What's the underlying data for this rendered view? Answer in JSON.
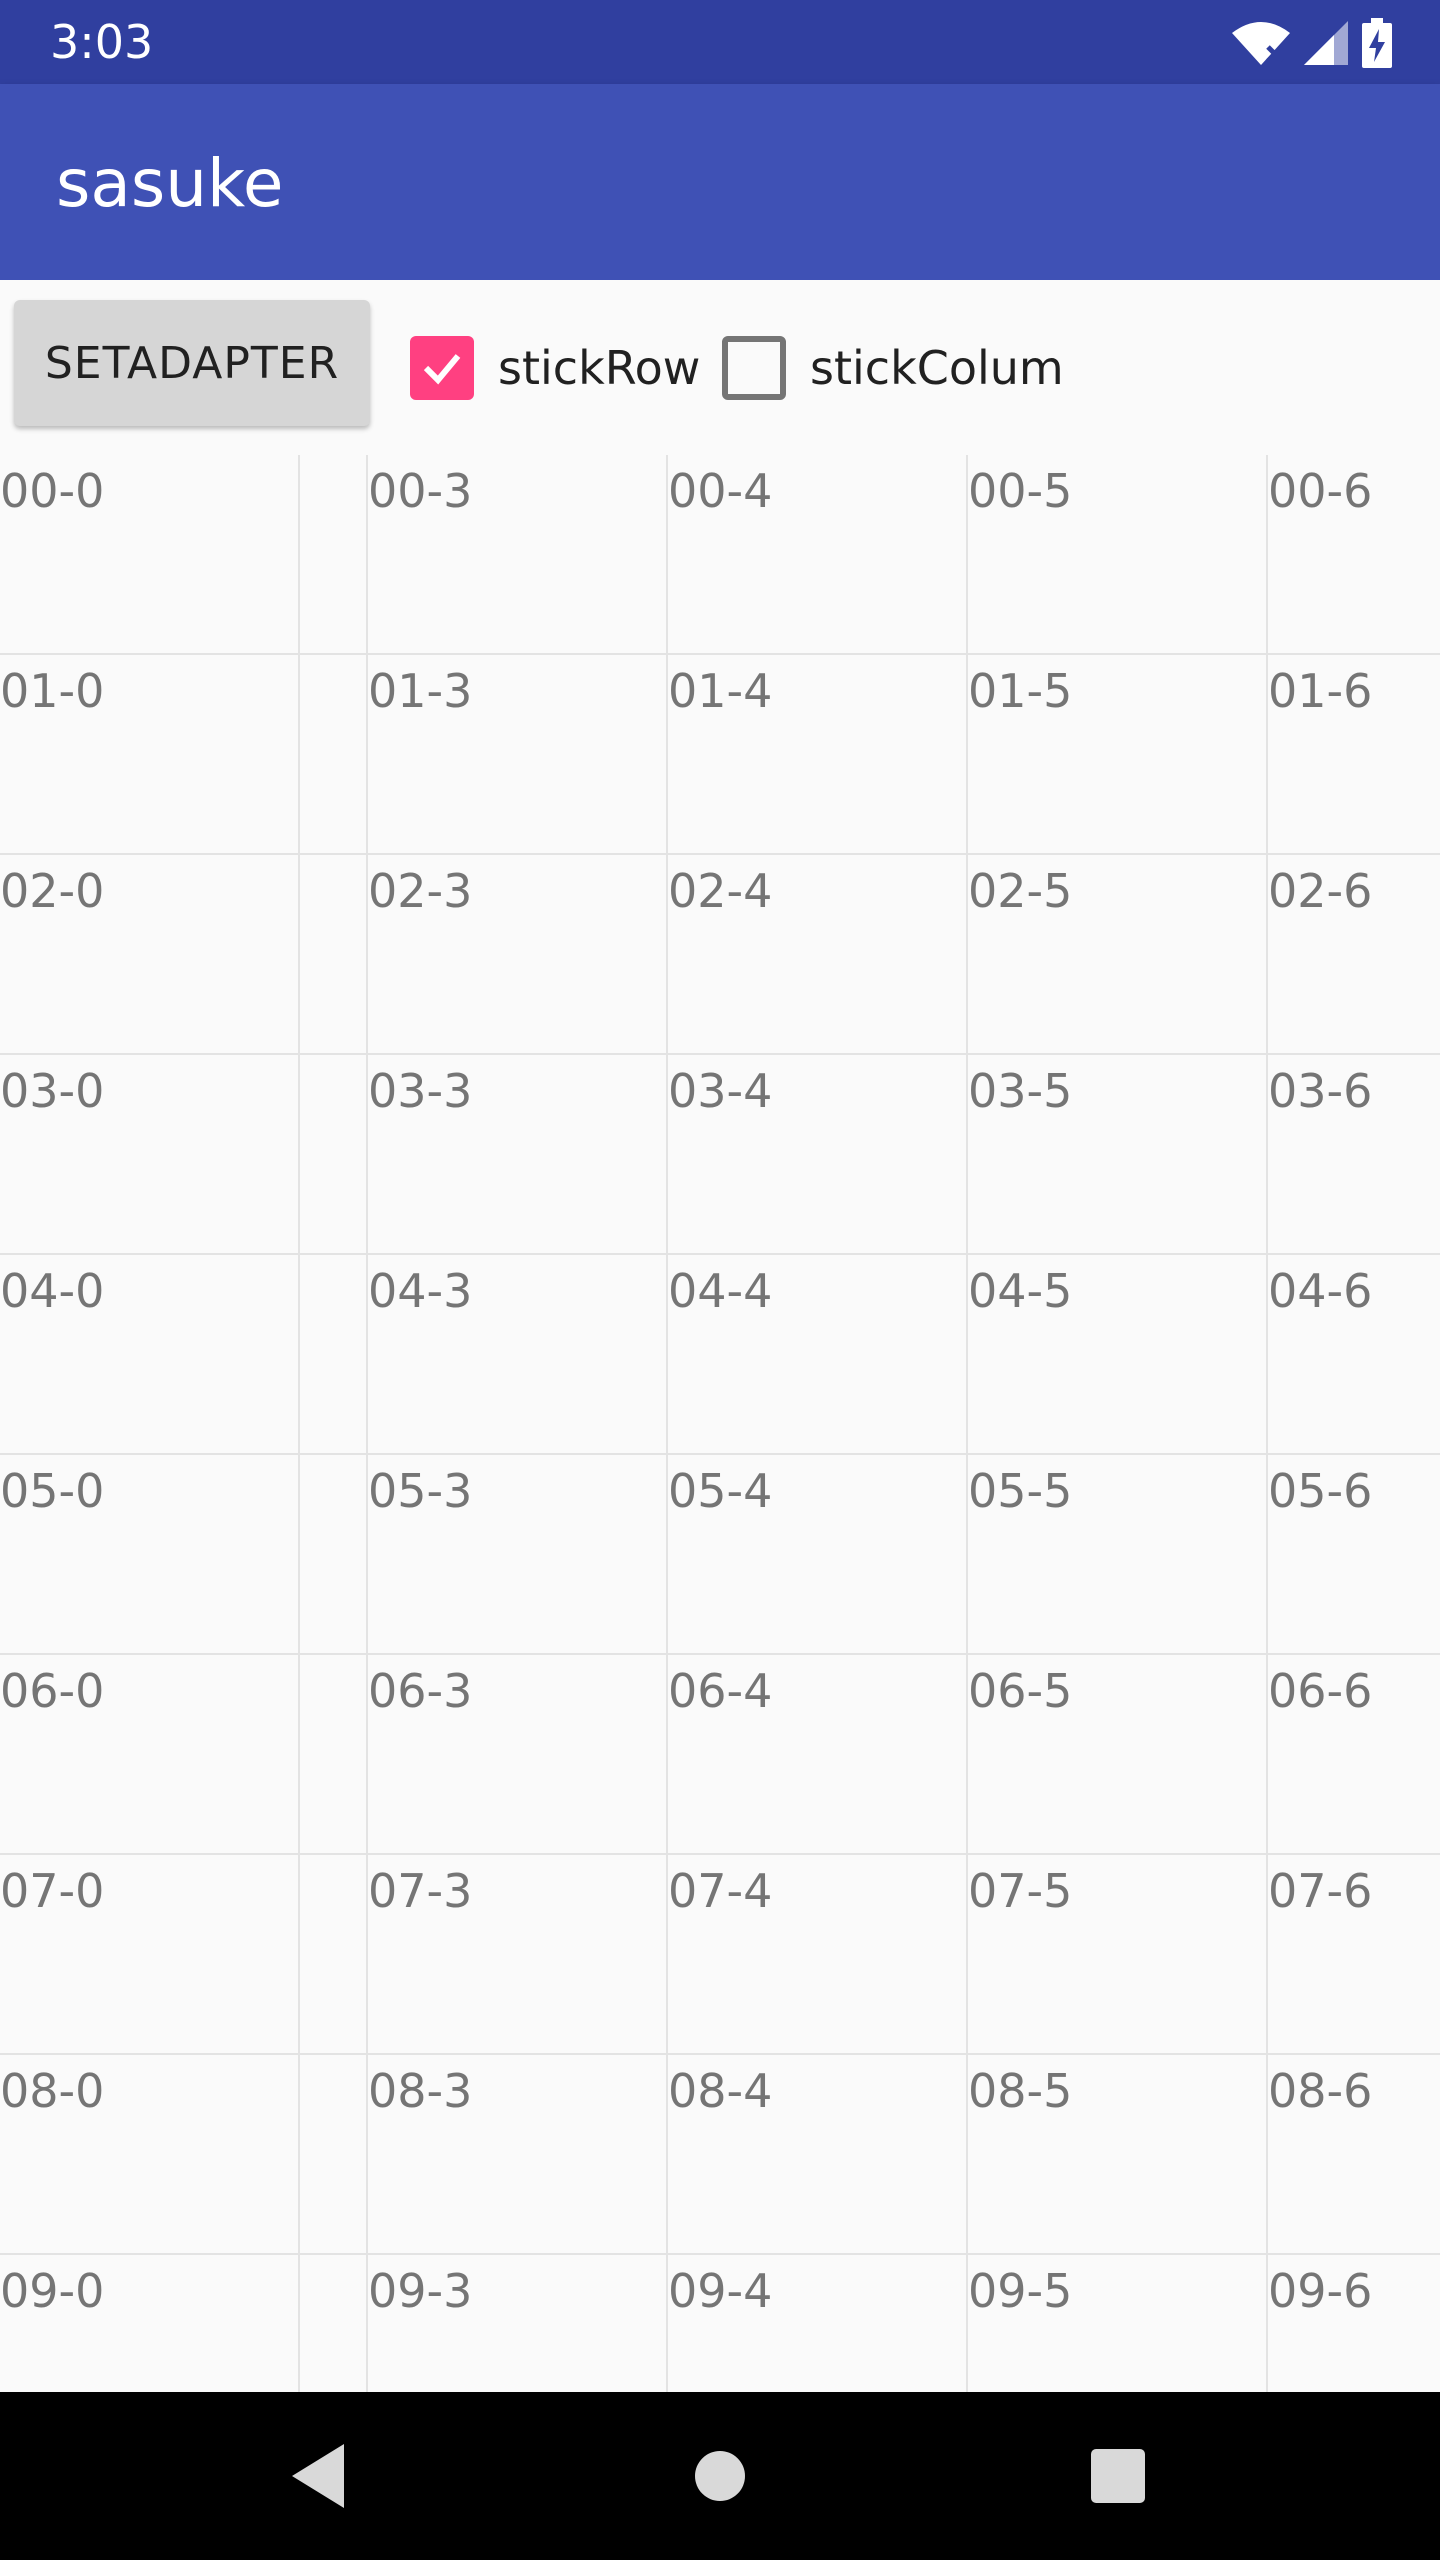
{
  "status_bar": {
    "time": "3:03",
    "icons": [
      "wifi-x-icon",
      "cell-signal-icon",
      "battery-charging-icon"
    ]
  },
  "app_bar": {
    "title": "sasuke"
  },
  "toolbar": {
    "setadapter_label": "SETADAPTER",
    "stick_row": {
      "label": "stickRow",
      "checked": true
    },
    "stick_colum": {
      "label": "stickColum",
      "checked": false
    }
  },
  "grid": {
    "rows": [
      [
        "00-0",
        "",
        "00-3",
        "00-4",
        "00-5",
        "00-6"
      ],
      [
        "01-0",
        "",
        "01-3",
        "01-4",
        "01-5",
        "01-6"
      ],
      [
        "02-0",
        "",
        "02-3",
        "02-4",
        "02-5",
        "02-6"
      ],
      [
        "03-0",
        "",
        "03-3",
        "03-4",
        "03-5",
        "03-6"
      ],
      [
        "04-0",
        "",
        "04-3",
        "04-4",
        "04-5",
        "04-6"
      ],
      [
        "05-0",
        "",
        "05-3",
        "05-4",
        "05-5",
        "05-6"
      ],
      [
        "06-0",
        "",
        "06-3",
        "06-4",
        "06-5",
        "06-6"
      ],
      [
        "07-0",
        "",
        "07-3",
        "07-4",
        "07-5",
        "07-6"
      ],
      [
        "08-0",
        "",
        "08-3",
        "08-4",
        "08-5",
        "08-6"
      ],
      [
        "09-0",
        "",
        "09-3",
        "09-4",
        "09-5",
        "09-6"
      ]
    ]
  },
  "nav_bar": {
    "icons": [
      "back-icon",
      "home-icon",
      "recents-icon"
    ]
  },
  "colors": {
    "status_bar": "#303f9f",
    "app_bar": "#3f51b5",
    "accent": "#ff4081"
  }
}
